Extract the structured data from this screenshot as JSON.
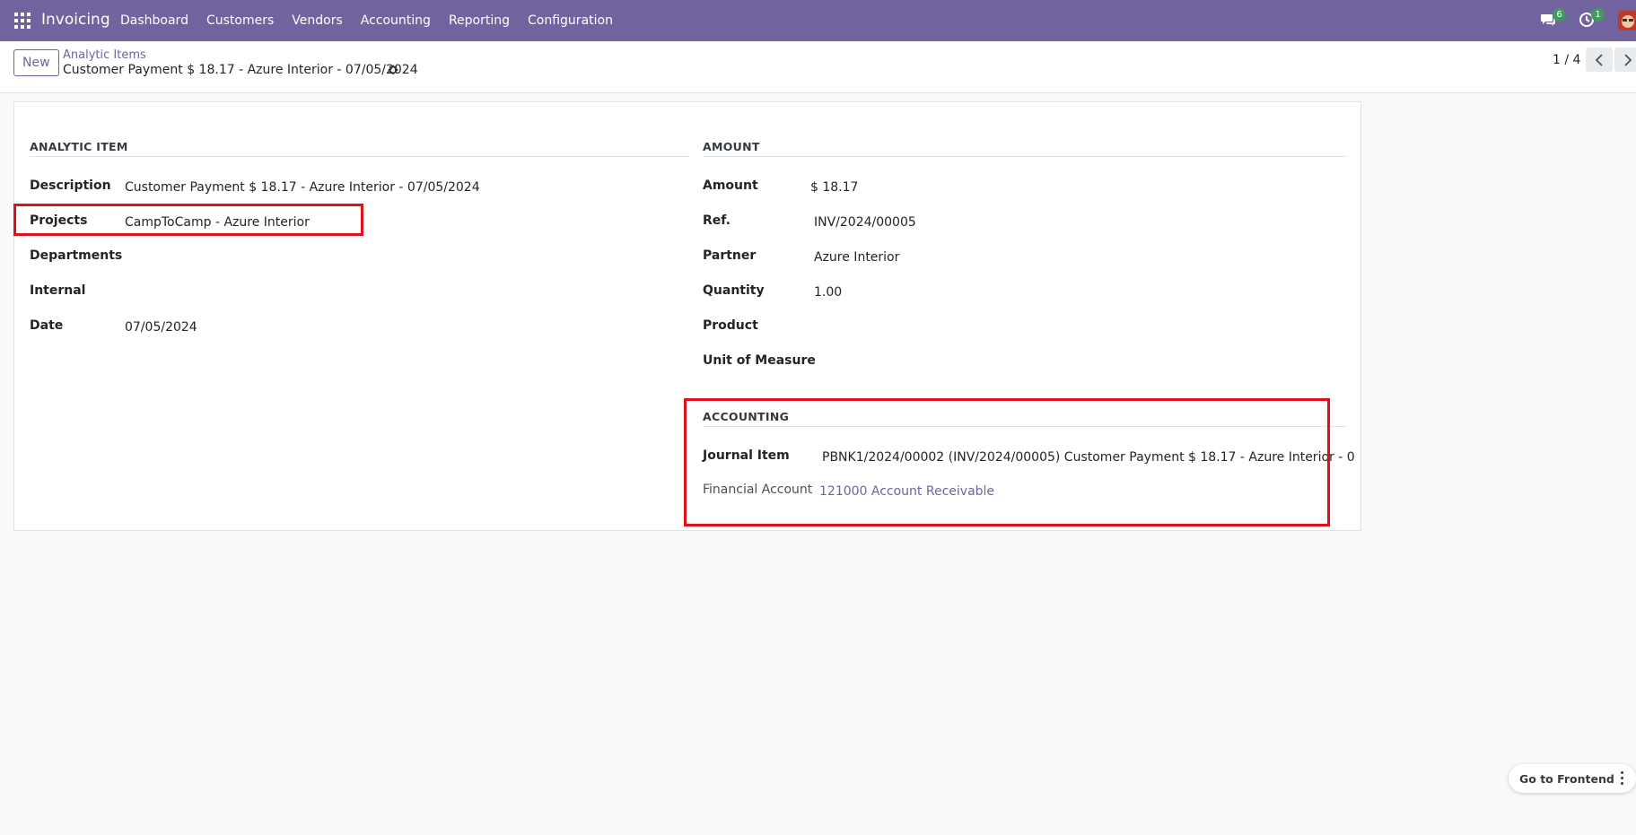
{
  "navbar": {
    "app_name": "Invoicing",
    "menu": [
      "Dashboard",
      "Customers",
      "Vendors",
      "Accounting",
      "Reporting",
      "Configuration"
    ],
    "messages_badge": "6",
    "activities_badge": "1"
  },
  "control_panel": {
    "new_label": "New",
    "breadcrumb_parent": "Analytic Items",
    "record_title": "Customer Payment $ 18.17 - Azure Interior - 07/05/2024",
    "pager": "1 / 4"
  },
  "analytic_item": {
    "title": "ANALYTIC ITEM",
    "fields": {
      "description": {
        "label": "Description",
        "value": "Customer Payment $ 18.17 - Azure Interior - 07/05/2024"
      },
      "projects": {
        "label": "Projects",
        "value": "CampToCamp - Azure Interior"
      },
      "departments": {
        "label": "Departments",
        "value": ""
      },
      "internal": {
        "label": "Internal",
        "value": ""
      },
      "date": {
        "label": "Date",
        "value": "07/05/2024"
      }
    }
  },
  "amount_group": {
    "title": "AMOUNT",
    "fields": {
      "amount": {
        "label": "Amount",
        "value": "$ 18.17"
      },
      "ref": {
        "label": "Ref.",
        "value": "INV/2024/00005"
      },
      "partner": {
        "label": "Partner",
        "value": "Azure Interior"
      },
      "quantity": {
        "label": "Quantity",
        "value": "1.00"
      },
      "product": {
        "label": "Product",
        "value": ""
      },
      "uom": {
        "label": "Unit of Measure",
        "value": ""
      }
    }
  },
  "accounting_group": {
    "title": "ACCOUNTING",
    "fields": {
      "journal_item": {
        "label": "Journal Item",
        "value": "PBNK1/2024/00002 (INV/2024/00005) Customer Payment $ 18.17 - Azure Interior - 0"
      },
      "financial_account": {
        "label": "Financial Account",
        "value": "121000 Account Receivable"
      }
    }
  },
  "footer": {
    "go_to_frontend": "Go to Frontend"
  },
  "colors": {
    "brand": "#71639e",
    "highlight": "#e0101a",
    "badge": "#3f9b5d"
  }
}
